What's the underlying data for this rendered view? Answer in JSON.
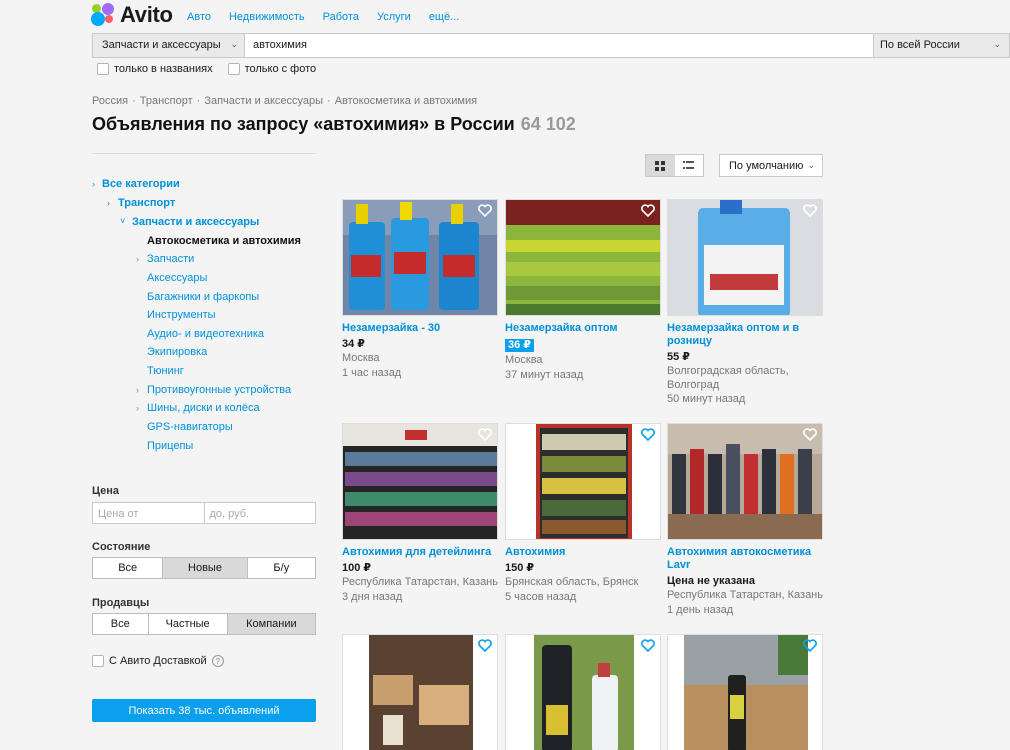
{
  "brand": {
    "name": "Avito"
  },
  "nav": [
    "Авто",
    "Недвижимость",
    "Работа",
    "Услуги",
    "ещё..."
  ],
  "search": {
    "category": "Запчасти и аксессуары",
    "query": "автохимия",
    "region": "По всей России"
  },
  "checkboxes": {
    "titles_only": "только в названиях",
    "with_photo": "только с фото"
  },
  "breadcrumbs": [
    "Россия",
    "Транспорт",
    "Запчасти и аксессуары",
    "Автокосметика и автохимия"
  ],
  "heading": {
    "text": "Объявления по запросу «автохимия» в России",
    "count": "64 102"
  },
  "tree": {
    "all": "Все категории",
    "transport": "Транспорт",
    "parts": "Запчасти и аксессуары",
    "current": "Автокосметика и автохимия",
    "children": [
      "Запчасти",
      "Аксессуары",
      "Багажники и фаркопы",
      "Инструменты",
      "Аудио- и видеотехника",
      "Экипировка",
      "Тюнинг",
      "Противоугонные устройства",
      "Шины, диски и колёса",
      "GPS-навигаторы",
      "Прицепы"
    ]
  },
  "filters": {
    "price_label": "Цена",
    "price_from": "Цена от",
    "price_to": "до, руб.",
    "condition_label": "Состояние",
    "condition": [
      "Все",
      "Новые",
      "Б/у"
    ],
    "sellers_label": "Продавцы",
    "sellers": [
      "Все",
      "Частные",
      "Компании"
    ],
    "delivery": "С Авито Доставкой",
    "help": "?",
    "show_button": "Показать 38 тыс. объявлений"
  },
  "sort": {
    "label": "По умолчанию"
  },
  "listings": [
    {
      "title": "Незамерзайка - 30",
      "price": "34 ₽",
      "location": "Москва",
      "time": "1 час назад"
    },
    {
      "title": "Незамерзайка оптом",
      "price": "36 ₽",
      "location": "Москва",
      "time": "37 минут назад"
    },
    {
      "title": "Незамерзайка оптом и в розницу",
      "price": "55 ₽",
      "location": "Волгоградская область, Волгоград",
      "time": "50 минут назад"
    },
    {
      "title": "Автохимия для детейлинга",
      "price": "100 ₽",
      "location": "Республика Татарстан, Казань",
      "time": "3 дня назад"
    },
    {
      "title": "Автохимия",
      "price": "150 ₽",
      "location": "Брянская область, Брянск",
      "time": "5 часов назад"
    },
    {
      "title": "Автохимия автокосметика Lavr",
      "price": "Цена не указана",
      "location": "Республика Татарстан, Казань",
      "time": "1 день назад"
    }
  ],
  "colors": {
    "link": "#0091d9",
    "accent": "#0aa0ee"
  }
}
